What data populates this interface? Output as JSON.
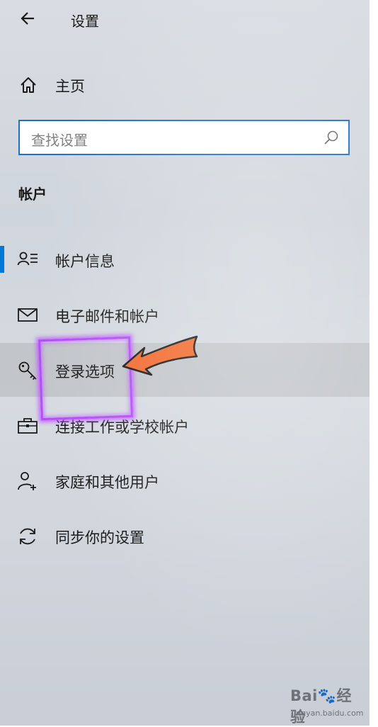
{
  "header": {
    "title": "设置"
  },
  "home": {
    "label": "主页"
  },
  "search": {
    "placeholder": "查找设置"
  },
  "section_title": "帐户",
  "nav_items": [
    {
      "label": "帐户信息",
      "icon": "account-info-icon",
      "active": true
    },
    {
      "label": "电子邮件和帐户",
      "icon": "mail-icon"
    },
    {
      "label": "登录选项",
      "icon": "key-icon",
      "hovered": true
    },
    {
      "label": "连接工作或学校帐户",
      "icon": "briefcase-icon"
    },
    {
      "label": "家庭和其他用户",
      "icon": "add-person-icon"
    },
    {
      "label": "同步你的设置",
      "icon": "sync-icon"
    }
  ],
  "colors": {
    "accent": "#0078d7",
    "annotation_box": "#b44cff",
    "annotation_arrow": "#f26a2e"
  },
  "watermark": {
    "mark": "Bai🐾经验",
    "url": "jingyan.baidu.com"
  }
}
